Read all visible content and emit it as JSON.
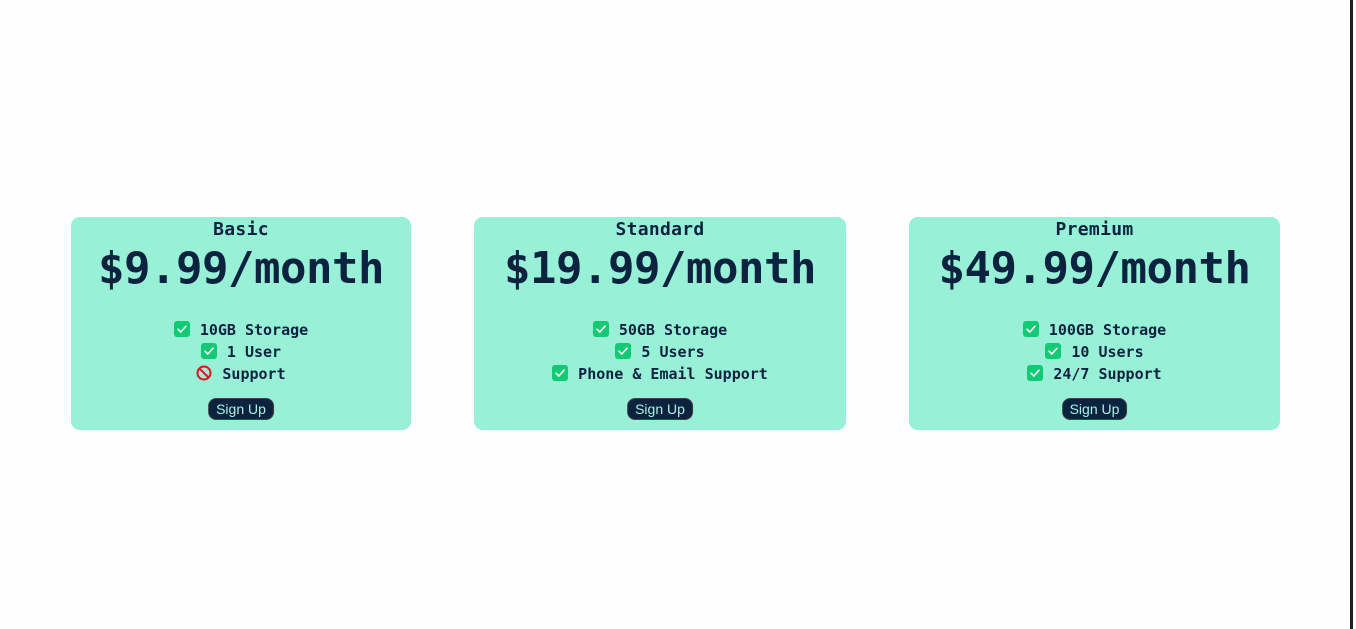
{
  "plans": [
    {
      "name": "Basic",
      "price": "$9.99/month",
      "features": [
        {
          "text": "10GB Storage",
          "icon": "check-icon",
          "included": true
        },
        {
          "text": "1 User",
          "icon": "check-icon",
          "included": true
        },
        {
          "text": "Support",
          "icon": "prohibited-icon",
          "included": false
        }
      ],
      "button_label": "Sign Up"
    },
    {
      "name": "Standard",
      "price": "$19.99/month",
      "features": [
        {
          "text": "50GB Storage",
          "icon": "check-icon",
          "included": true
        },
        {
          "text": "5 Users",
          "icon": "check-icon",
          "included": true
        },
        {
          "text": "Phone & Email Support",
          "icon": "check-icon",
          "included": true
        }
      ],
      "button_label": "Sign Up"
    },
    {
      "name": "Premium",
      "price": "$49.99/month",
      "features": [
        {
          "text": "100GB Storage",
          "icon": "check-icon",
          "included": true
        },
        {
          "text": "10 Users",
          "icon": "check-icon",
          "included": true
        },
        {
          "text": "24/7 Support",
          "icon": "check-icon",
          "included": true
        }
      ],
      "button_label": "Sign Up"
    }
  ],
  "colors": {
    "card_bg": "#98f0d6",
    "text": "#0c2340",
    "check": "#12c974",
    "prohibited": "#e0101c",
    "button_bg": "#0c2340",
    "button_text": "#a7f3e2"
  }
}
